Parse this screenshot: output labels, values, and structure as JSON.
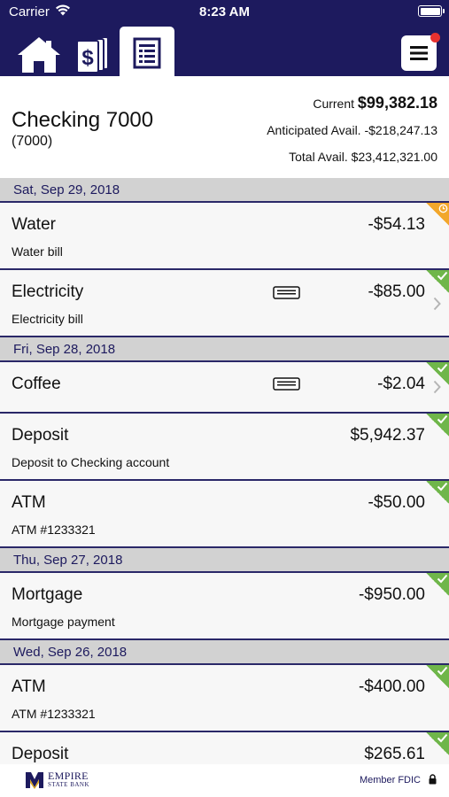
{
  "status_bar": {
    "carrier": "Carrier",
    "time": "8:23 AM"
  },
  "nav": {
    "tabs": [
      {
        "icon": "home-icon"
      },
      {
        "icon": "money-icon"
      },
      {
        "icon": "register-icon",
        "selected": true
      }
    ],
    "menu_icon": "hamburger-icon",
    "has_notification": true
  },
  "account": {
    "name": "Checking 7000",
    "number": "(7000)",
    "current_label": "Current",
    "current_value": "$99,382.18",
    "anticipated_label": "Anticipated Avail.",
    "anticipated_value": "-$218,247.13",
    "total_label": "Total Avail.",
    "total_value": "$23,412,321.00"
  },
  "groups": [
    {
      "date": "Sat, Sep 29, 2018",
      "transactions": [
        {
          "name": "Water",
          "desc": "Water bill",
          "amount": "-$54.13",
          "status": "pending"
        },
        {
          "name": "Electricity",
          "desc": "Electricity bill",
          "amount": "-$85.00",
          "status": "cleared",
          "memo": true,
          "chevron": true
        }
      ]
    },
    {
      "date": "Fri, Sep 28, 2018",
      "transactions": [
        {
          "name": "Coffee",
          "desc": "",
          "amount": "-$2.04",
          "status": "cleared",
          "memo": true,
          "chevron": true
        },
        {
          "name": "Deposit",
          "desc": "Deposit to Checking account",
          "amount": "$5,942.37",
          "status": "cleared"
        },
        {
          "name": "ATM",
          "desc": "ATM #1233321",
          "amount": "-$50.00",
          "status": "cleared"
        }
      ]
    },
    {
      "date": "Thu, Sep 27, 2018",
      "transactions": [
        {
          "name": "Mortgage",
          "desc": "Mortgage payment",
          "amount": "-$950.00",
          "status": "cleared"
        }
      ]
    },
    {
      "date": "Wed, Sep 26, 2018",
      "transactions": [
        {
          "name": "ATM",
          "desc": "ATM #1233321",
          "amount": "-$400.00",
          "status": "cleared"
        },
        {
          "name": "Deposit",
          "desc": "",
          "amount": "$265.61",
          "status": "cleared"
        }
      ]
    }
  ],
  "footer": {
    "logo_line1": "EMPIRE",
    "logo_line2": "STATE BANK",
    "fdic": "Member FDIC"
  },
  "colors": {
    "brand_navy": "#1d1a5e",
    "cleared_green": "#6fb64a",
    "pending_orange": "#f2a72b",
    "notification_red": "#e8312f",
    "header_gray": "#d2d2d2"
  }
}
